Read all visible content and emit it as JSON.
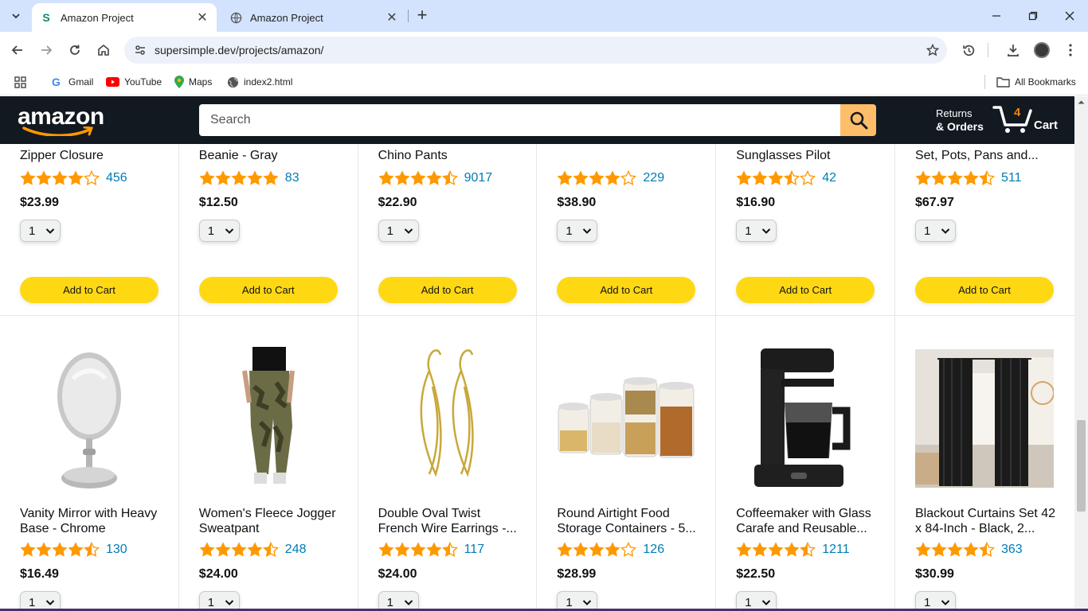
{
  "browser": {
    "tabs": [
      {
        "title": "Amazon Project",
        "active": true
      },
      {
        "title": "Amazon Project",
        "active": false
      }
    ],
    "url": "supersimple.dev/projects/amazon/",
    "bookmarks": [
      {
        "label": "Gmail",
        "icon": "gmail-icon"
      },
      {
        "label": "YouTube",
        "icon": "youtube-icon"
      },
      {
        "label": "Maps",
        "icon": "maps-icon"
      },
      {
        "label": "index2.html",
        "icon": "globe-icon"
      }
    ],
    "all_bookmarks": "All Bookmarks"
  },
  "header": {
    "logo": "amazon",
    "search_placeholder": "Search",
    "returns_line1": "Returns",
    "returns_line2": "& Orders",
    "cart_count": "4",
    "cart_label": "Cart"
  },
  "add_to_cart_label": "Add to Cart",
  "products_row1": [
    {
      "name": "Zipper Closure",
      "stars": 4.0,
      "rating_count": "456",
      "price": "$23.99",
      "qty": "1"
    },
    {
      "name": "Beanie - Gray",
      "stars": 5.0,
      "rating_count": "83",
      "price": "$12.50",
      "qty": "1"
    },
    {
      "name": "Chino Pants",
      "stars": 4.5,
      "rating_count": "9017",
      "price": "$22.90",
      "qty": "1"
    },
    {
      "name": "",
      "stars": 4.0,
      "rating_count": "229",
      "price": "$38.90",
      "qty": "1"
    },
    {
      "name": "Sunglasses Pilot",
      "stars": 3.5,
      "rating_count": "42",
      "price": "$16.90",
      "qty": "1"
    },
    {
      "name": "Set, Pots, Pans and...",
      "stars": 4.5,
      "rating_count": "511",
      "price": "$67.97",
      "qty": "1"
    }
  ],
  "products_row2": [
    {
      "name": "Vanity Mirror with Heavy Base - Chrome",
      "image": "vanity-mirror",
      "stars": 4.5,
      "rating_count": "130",
      "price": "$16.49",
      "qty": "1"
    },
    {
      "name": "Women's Fleece Jogger Sweatpant",
      "image": "jogger-sweatpant",
      "stars": 4.5,
      "rating_count": "248",
      "price": "$24.00",
      "qty": "1"
    },
    {
      "name": "Double Oval Twist French Wire Earrings -...",
      "image": "earrings",
      "stars": 4.5,
      "rating_count": "117",
      "price": "$24.00",
      "qty": "1"
    },
    {
      "name": "Round Airtight Food Storage Containers - 5...",
      "image": "food-containers",
      "stars": 4.0,
      "rating_count": "126",
      "price": "$28.99",
      "qty": "1"
    },
    {
      "name": "Coffeemaker with Glass Carafe and Reusable...",
      "image": "coffeemaker",
      "stars": 4.5,
      "rating_count": "1211",
      "price": "$22.50",
      "qty": "1"
    },
    {
      "name": "Blackout Curtains Set 42 x 84-Inch - Black, 2...",
      "image": "blackout-curtains",
      "stars": 4.5,
      "rating_count": "363",
      "price": "$30.99",
      "qty": "1"
    }
  ],
  "colors": {
    "header_bg": "#131921",
    "search_button": "#febd69",
    "add_to_cart": "#ffd814",
    "star": "#ff9900",
    "link": "#017cb6",
    "cart_count": "#f08804"
  }
}
